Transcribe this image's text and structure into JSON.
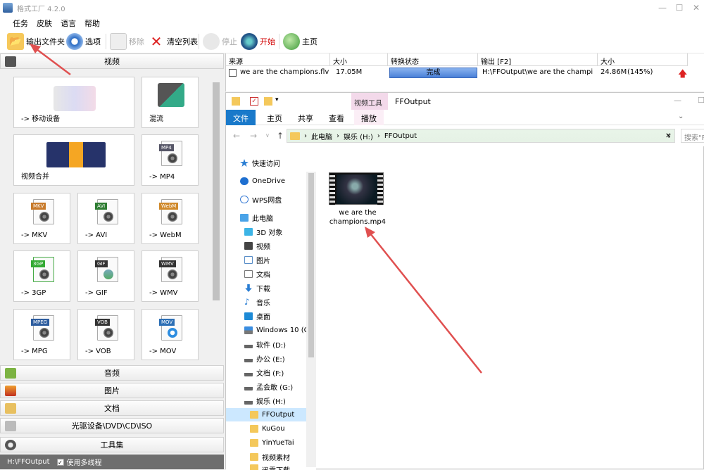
{
  "app": {
    "title": "格式工厂 4.2.0"
  },
  "menu": [
    "任务",
    "皮肤",
    "语言",
    "帮助"
  ],
  "toolbar": {
    "output_folder": "输出文件夹",
    "options": "选项",
    "remove": "移除",
    "clear_list": "清空列表",
    "stop": "停止",
    "start": "开始",
    "home": "主页"
  },
  "categories": {
    "video": "视频",
    "audio": "音频",
    "image": "图片",
    "document": "文档",
    "disc": "光驱设备\\DVD\\CD\\ISO",
    "tools": "工具集"
  },
  "tiles": {
    "mobile": "-> 移动设备",
    "mix": "混流",
    "merge": "视频合并",
    "mp4": "-> MP4",
    "mkv": "-> MKV",
    "avi": "-> AVI",
    "webm": "-> WebM",
    "3gp": "-> 3GP",
    "gif": "-> GIF",
    "wmv": "-> WMV",
    "mpg": "-> MPG",
    "vob": "-> VOB",
    "mov": "-> MOV"
  },
  "file_tags": {
    "mp4": "MP4",
    "mkv": "MKV",
    "avi": "AVI",
    "webm": "WebM",
    "3gp": "3GP",
    "gif": "GIF",
    "wmv": "WMV",
    "mpeg": "MPEG",
    "vob": "VOB",
    "mov": "MOV"
  },
  "status": {
    "path": "H:\\FFOutput",
    "multithread": "使用多线程",
    "checked": "✓"
  },
  "task_table": {
    "headers": [
      "来源",
      "大小",
      "转换状态",
      "输出 [F2]",
      "大小"
    ],
    "row": {
      "source": "we are the champions.flv",
      "size": "17.05M",
      "state": "完成",
      "output": "H:\\FFOutput\\we are the champi",
      "out_size": "24.86M",
      "ratio": "(145%)"
    }
  },
  "explorer": {
    "title": "FFOutput",
    "ribbon_context": "视频工具",
    "tabs": [
      "文件",
      "主页",
      "共享",
      "查看",
      "播放"
    ],
    "path": [
      "此电脑",
      "娱乐 (H:)",
      "FFOutput"
    ],
    "search_placeholder": "搜索\"FFOutput\"",
    "nav": [
      {
        "label": "快速访问"
      },
      {
        "label": "OneDrive"
      },
      {
        "label": "WPS网盘"
      },
      {
        "label": "此电脑"
      },
      {
        "label": "3D 对象"
      },
      {
        "label": "视频"
      },
      {
        "label": "图片"
      },
      {
        "label": "文档"
      },
      {
        "label": "下载"
      },
      {
        "label": "音乐"
      },
      {
        "label": "桌面"
      },
      {
        "label": "Windows 10 (C"
      },
      {
        "label": "软件 (D:)"
      },
      {
        "label": "办公 (E:)"
      },
      {
        "label": "文档 (F:)"
      },
      {
        "label": "孟会敢 (G:)"
      },
      {
        "label": "娱乐 (H:)"
      },
      {
        "label": "FFOutput"
      },
      {
        "label": "KuGou"
      },
      {
        "label": "YinYueTai"
      },
      {
        "label": "视频素材"
      },
      {
        "label": "迅雷下载"
      }
    ],
    "file": {
      "name": "we are the champions.mp4"
    }
  },
  "colors": {
    "progress": "#4a80d8",
    "arrow": "#e05050",
    "selected": "#cce8ff",
    "folder": "#f4c85b"
  }
}
